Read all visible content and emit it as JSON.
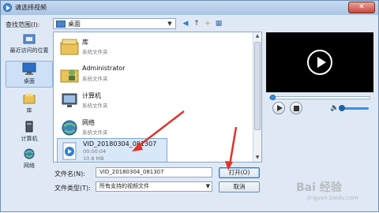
{
  "window": {
    "title": "请选择视频",
    "close_label": "✕"
  },
  "lookin": {
    "label": "查找范围(I):",
    "value": "桌面"
  },
  "toolbar": {
    "back": "◀",
    "up": "↑",
    "new_folder": "+",
    "views": "▦"
  },
  "nav": [
    {
      "label": "最近访问的位置"
    },
    {
      "label": "桌面"
    },
    {
      "label": "库"
    },
    {
      "label": "计算机"
    },
    {
      "label": "网络"
    }
  ],
  "files": [
    {
      "name": "库",
      "sub": "系统文件夹"
    },
    {
      "name": "Administrator",
      "sub": "系统文件夹"
    },
    {
      "name": "计算机",
      "sub": "系统文件夹"
    },
    {
      "name": "网络",
      "sub": "系统文件夹"
    },
    {
      "name": "VID_20180304_081307",
      "sub": "00:00:04",
      "sub2": "10.8 MB"
    }
  ],
  "filename": {
    "label": "文件名(N):",
    "value": "VID_20180304_081307"
  },
  "filetype": {
    "label": "文件类型(T):",
    "value": "所有支持的视频文件"
  },
  "buttons": {
    "open": "打开(O)",
    "cancel": "取消"
  },
  "watermark": {
    "text": "Bai 经验",
    "sub": "jingyan.baidu.com"
  },
  "colors": {
    "accent": "#3a8fe0",
    "annotation": "#e0332a"
  }
}
